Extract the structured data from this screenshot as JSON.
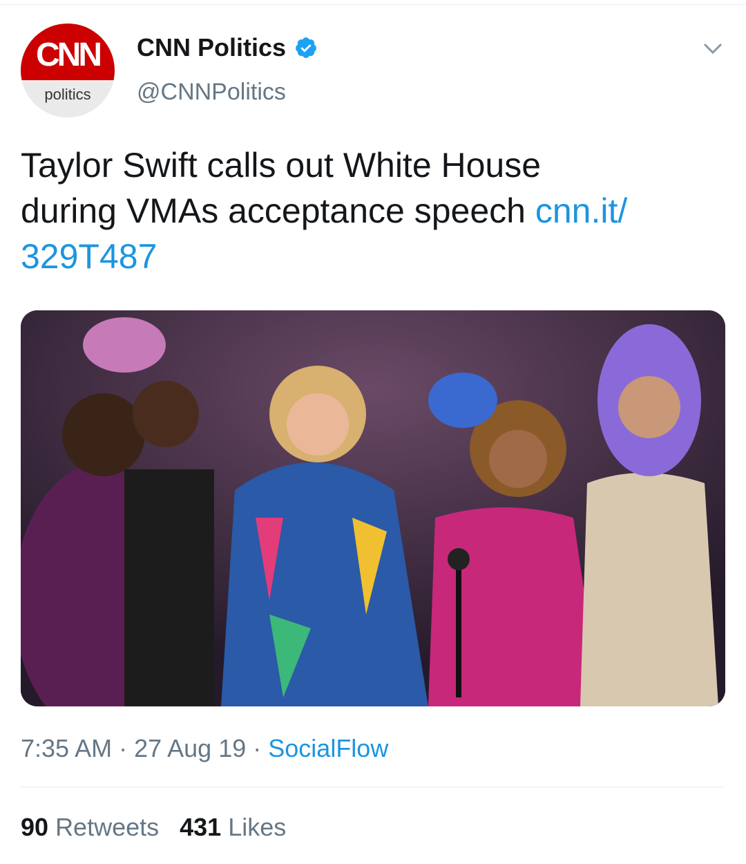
{
  "header": {
    "avatar_logo": "CNN",
    "avatar_sub": "politics",
    "display_name": "CNN Politics",
    "handle": "@CNNPolitics"
  },
  "tweet": {
    "text_line1": "Taylor Swift calls out White House",
    "text_line2": "during VMAs acceptance speech ",
    "link_part1": "cnn.it/",
    "link_part2": "329T487"
  },
  "meta": {
    "time": "7:35 AM",
    "date": "27 Aug 19",
    "separator": " · ",
    "source": "SocialFlow"
  },
  "stats": {
    "retweets_count": "90",
    "retweets_label": "Retweets",
    "likes_count": "431",
    "likes_label": "Likes"
  },
  "colors": {
    "link": "#1b95e0",
    "verified": "#1da1f2",
    "cnn_red": "#cc0000"
  },
  "icons": {
    "verified": "verified-badge-icon",
    "menu": "chevron-down-icon"
  }
}
